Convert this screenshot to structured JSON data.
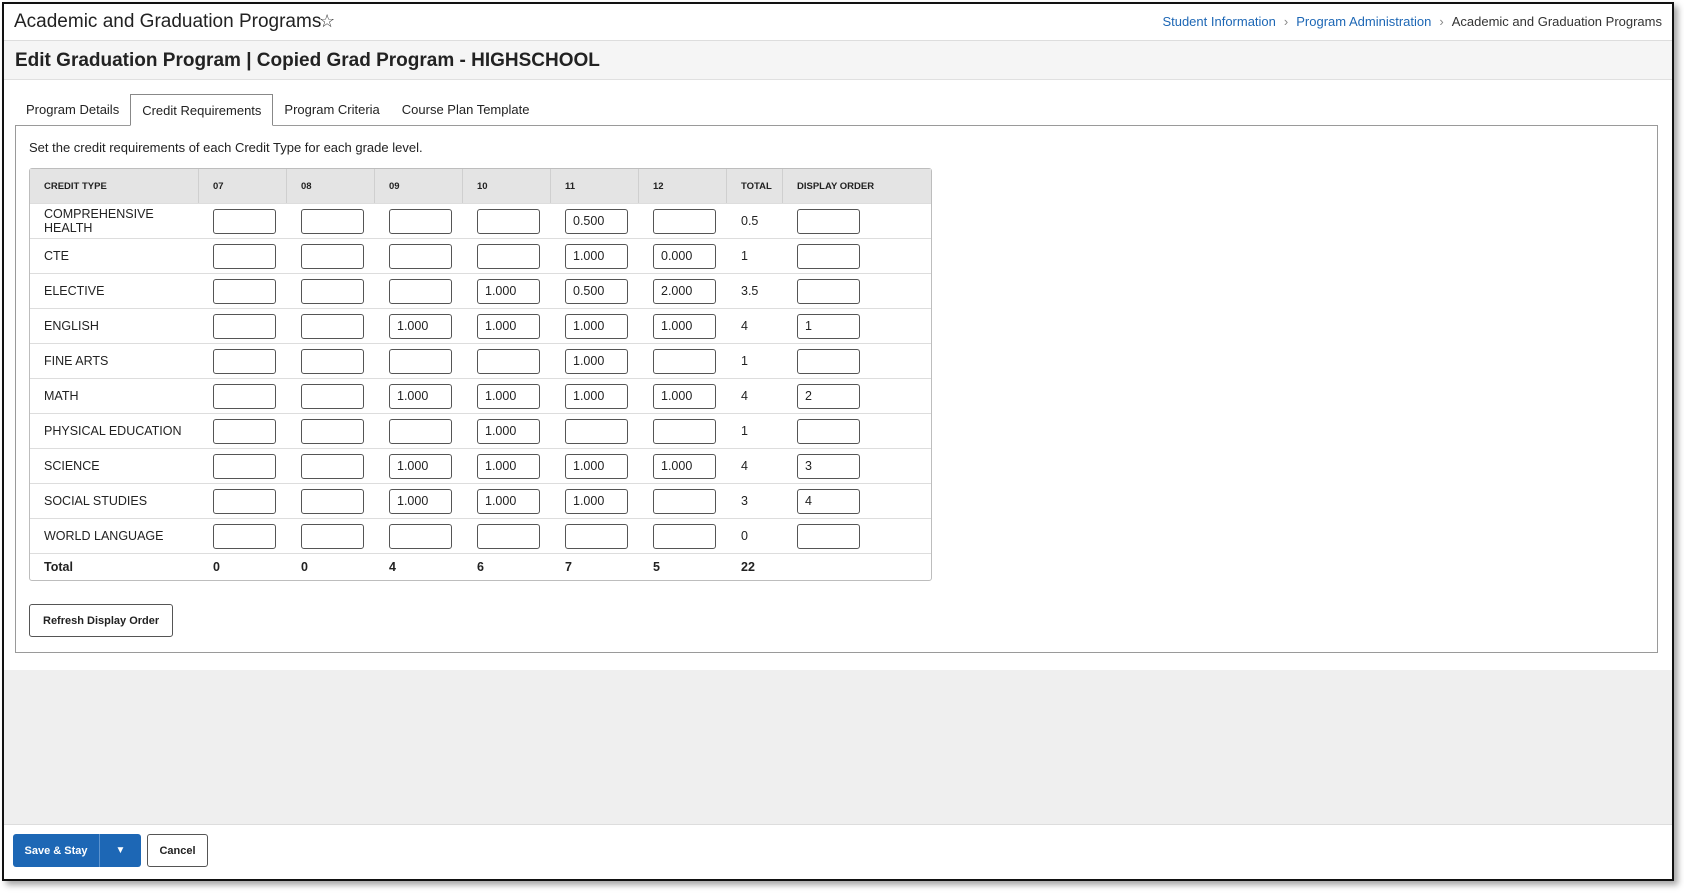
{
  "header": {
    "app_title": "Academic and Graduation Programs",
    "favorite_icon": "star-outline-icon",
    "breadcrumb": [
      "Student Information",
      "Program Administration",
      "Academic and Graduation Programs"
    ]
  },
  "page_title": "Edit Graduation Program | Copied Grad Program - HIGHSCHOOL",
  "tabs": [
    "Program Details",
    "Credit Requirements",
    "Program Criteria",
    "Course Plan Template"
  ],
  "active_tab": "Credit Requirements",
  "instructions": "Set the credit requirements of each Credit Type for each grade level.",
  "table": {
    "columns": [
      "CREDIT TYPE",
      "07",
      "08",
      "09",
      "10",
      "11",
      "12",
      "TOTAL",
      "DISPLAY ORDER"
    ],
    "rows": [
      {
        "type": "COMPREHENSIVE HEALTH",
        "g07": "",
        "g08": "",
        "g09": "",
        "g10": "",
        "g11": "0.500",
        "g12": "",
        "total": "0.5",
        "order": ""
      },
      {
        "type": "CTE",
        "g07": "",
        "g08": "",
        "g09": "",
        "g10": "",
        "g11": "1.000",
        "g12": "0.000",
        "total": "1",
        "order": ""
      },
      {
        "type": "ELECTIVE",
        "g07": "",
        "g08": "",
        "g09": "",
        "g10": "1.000",
        "g11": "0.500",
        "g12": "2.000",
        "total": "3.5",
        "order": ""
      },
      {
        "type": "ENGLISH",
        "g07": "",
        "g08": "",
        "g09": "1.000",
        "g10": "1.000",
        "g11": "1.000",
        "g12": "1.000",
        "total": "4",
        "order": "1"
      },
      {
        "type": "FINE ARTS",
        "g07": "",
        "g08": "",
        "g09": "",
        "g10": "",
        "g11": "1.000",
        "g12": "",
        "total": "1",
        "order": ""
      },
      {
        "type": "MATH",
        "g07": "",
        "g08": "",
        "g09": "1.000",
        "g10": "1.000",
        "g11": "1.000",
        "g12": "1.000",
        "total": "4",
        "order": "2"
      },
      {
        "type": "PHYSICAL EDUCATION",
        "g07": "",
        "g08": "",
        "g09": "",
        "g10": "1.000",
        "g11": "",
        "g12": "",
        "total": "1",
        "order": ""
      },
      {
        "type": "SCIENCE",
        "g07": "",
        "g08": "",
        "g09": "1.000",
        "g10": "1.000",
        "g11": "1.000",
        "g12": "1.000",
        "total": "4",
        "order": "3"
      },
      {
        "type": "SOCIAL STUDIES",
        "g07": "",
        "g08": "",
        "g09": "1.000",
        "g10": "1.000",
        "g11": "1.000",
        "g12": "",
        "total": "3",
        "order": "4"
      },
      {
        "type": "WORLD LANGUAGE",
        "g07": "",
        "g08": "",
        "g09": "",
        "g10": "",
        "g11": "",
        "g12": "",
        "total": "0",
        "order": ""
      }
    ],
    "totals": {
      "label": "Total",
      "g07": "0",
      "g08": "0",
      "g09": "4",
      "g10": "6",
      "g11": "7",
      "g12": "5",
      "total": "22"
    }
  },
  "buttons": {
    "refresh": "Refresh Display Order",
    "save": "Save & Stay",
    "save_menu_icon": "caret-down-icon",
    "cancel": "Cancel"
  }
}
